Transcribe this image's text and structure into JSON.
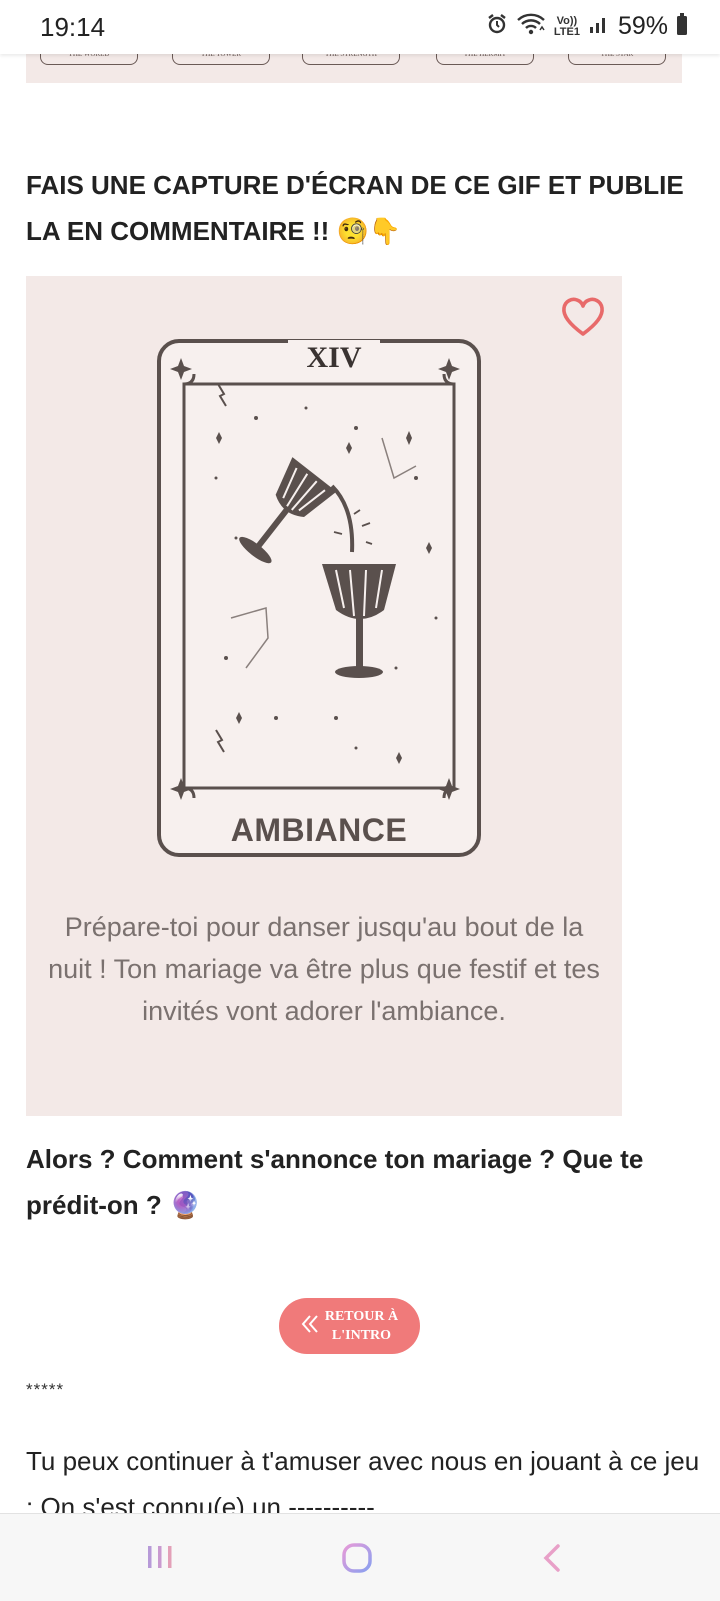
{
  "status_bar": {
    "time": "19:14",
    "volte_line1": "Vo))",
    "volte_line2": "LTE1",
    "battery": "59%",
    "icons": [
      "alarm-icon",
      "wifi-icon",
      "volte-icon",
      "signal-icon",
      "battery-icon"
    ]
  },
  "top_strip": {
    "cards": [
      "THE WORLD",
      "THE TOWER",
      "THE STRENGTH",
      "THE HERMIT",
      "THE STAR"
    ]
  },
  "section": {
    "title": "FAIS UNE CAPTURE D'ÉCRAN DE CE GIF ET PUBLIE LA EN COMMENTAIRE !! 🧐👇"
  },
  "tarot": {
    "number": "XIV",
    "name": "AMBIANCE",
    "text": "Prépare-toi pour danser jusqu'au bout de la nuit ! Ton mariage va être plus que festif et tes invités vont adorer l'ambiance.",
    "accent": "#e86a6a",
    "background": "#f3e9e7"
  },
  "question": {
    "text": "Alors ? Comment s'annonce ton mariage ? Que te prédit-on ? 🔮"
  },
  "back_button": {
    "label": "RETOUR À\nL'INTRO",
    "color": "#f07a7a"
  },
  "separator": "*****",
  "continue": {
    "text": "Tu peux continuer à t'amuser avec nous en jouant à ce jeu : On s'est connu(e) un ----------"
  },
  "nav": {
    "icons": [
      "recent-apps-icon",
      "home-icon",
      "back-icon"
    ]
  }
}
